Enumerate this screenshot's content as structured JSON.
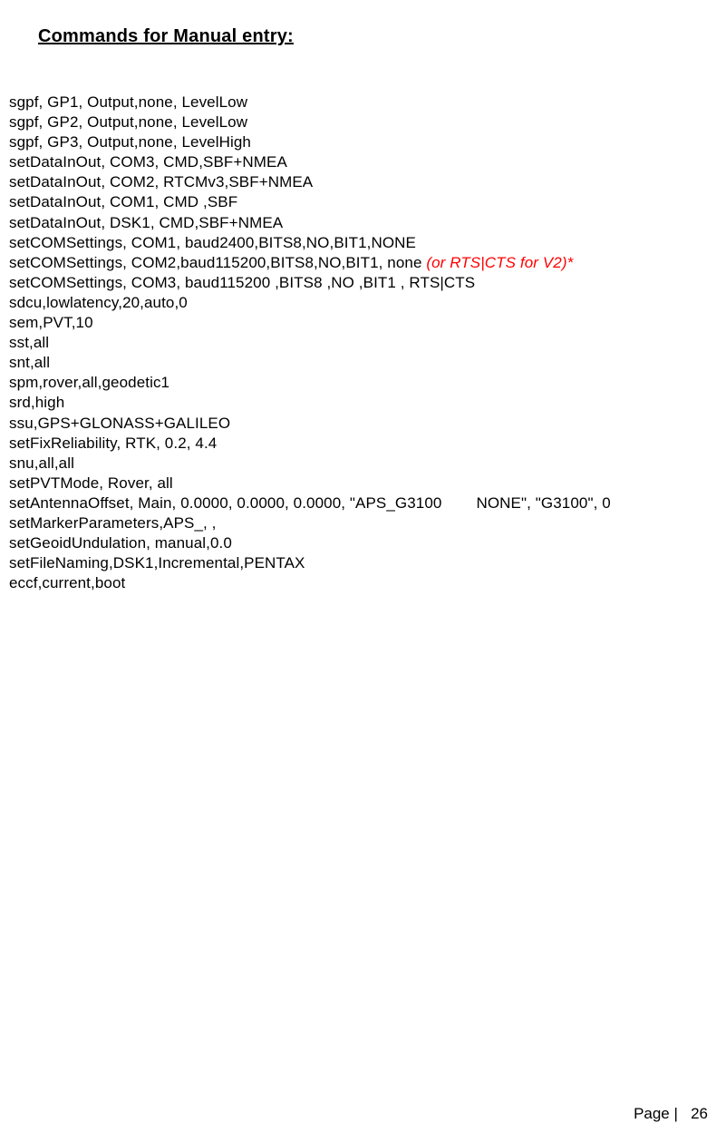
{
  "heading": "Commands for Manual entry:",
  "commands": [
    {
      "text": "sgpf, GP1, Output,none, LevelLow"
    },
    {
      "text": "sgpf, GP2, Output,none, LevelLow"
    },
    {
      "text": "sgpf, GP3, Output,none, LevelHigh"
    },
    {
      "text": "setDataInOut, COM3, CMD,SBF+NMEA"
    },
    {
      "text": "setDataInOut, COM2, RTCMv3,SBF+NMEA"
    },
    {
      "text": "setDataInOut, COM1, CMD ,SBF"
    },
    {
      "text": "setDataInOut, DSK1, CMD,SBF+NMEA"
    },
    {
      "text": "setCOMSettings, COM1, baud2400,BITS8,NO,BIT1,NONE"
    },
    {
      "text": "setCOMSettings, COM2,baud115200,BITS8,NO,BIT1, none",
      "annotation": "  (or RTS|CTS for V2)*"
    },
    {
      "text": "setCOMSettings, COM3, baud115200 ,BITS8 ,NO ,BIT1 , RTS|CTS"
    },
    {
      "text": "sdcu,lowlatency,20,auto,0"
    },
    {
      "text": "sem,PVT,10"
    },
    {
      "text": "sst,all"
    },
    {
      "text": "snt,all"
    },
    {
      "text": "spm,rover,all,geodetic1"
    },
    {
      "text": "srd,high"
    },
    {
      "text": "ssu,GPS+GLONASS+GALILEO"
    },
    {
      "text": "setFixReliability, RTK, 0.2, 4.4"
    },
    {
      "text": "snu,all,all"
    },
    {
      "text": "setPVTMode, Rover, all"
    },
    {
      "text": "setAntennaOffset, Main, 0.0000, 0.0000, 0.0000, \"APS_G3100",
      "gap": true,
      "text2": "NONE\", \"G3100\", 0"
    },
    {
      "text": "setMarkerParameters,APS_, ,"
    },
    {
      "text": "setGeoidUndulation, manual,0.0"
    },
    {
      "text": "setFileNaming,DSK1,Incremental,PENTAX"
    },
    {
      "text": "eccf,current,boot"
    }
  ],
  "footer": {
    "label": "Page |",
    "number": "26"
  }
}
